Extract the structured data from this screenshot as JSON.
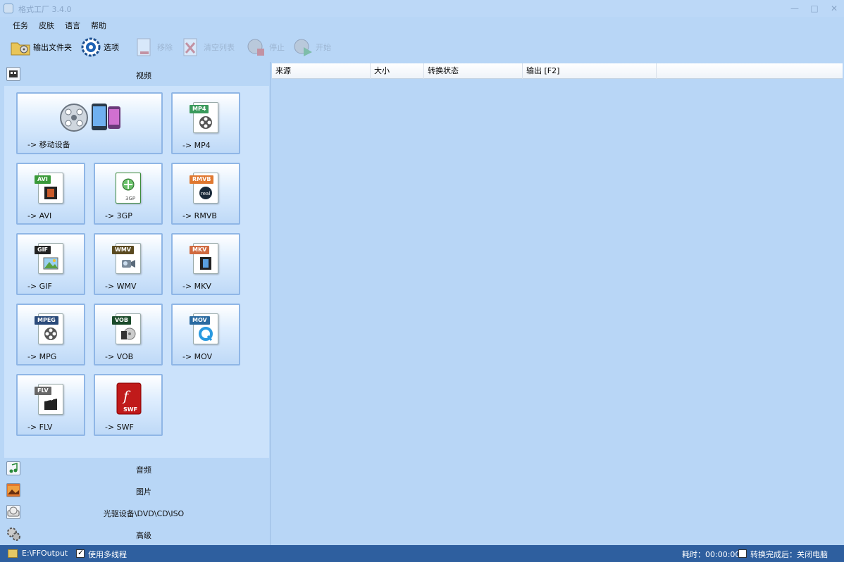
{
  "window": {
    "title": "格式工厂 3.4.0",
    "minimize": "—",
    "maximize": "□",
    "close": "✕"
  },
  "menu": [
    "任务",
    "皮肤",
    "语言",
    "帮助"
  ],
  "toolbar": {
    "output_folder": "输出文件夹",
    "options": "选项",
    "remove": "移除",
    "clear_list": "清空列表",
    "stop": "停止",
    "start": "开始"
  },
  "categories": {
    "video": "视频",
    "audio": "音频",
    "picture": "图片",
    "optical": "光驱设备\\DVD\\CD\\ISO",
    "advanced": "高级"
  },
  "video_tiles": [
    {
      "label": "-> 移动设备",
      "tag": ""
    },
    {
      "label": "-> MP4",
      "tag": "MP4",
      "color": "#3a9a5c"
    },
    {
      "label": "-> AVI",
      "tag": "AVI",
      "color": "#3a9a3a"
    },
    {
      "label": "-> 3GP",
      "tag": "3GP",
      "color": "#4aa050"
    },
    {
      "label": "-> RMVB",
      "tag": "RMVB",
      "color": "#e07830"
    },
    {
      "label": "-> GIF",
      "tag": "GIF",
      "color": "#222222"
    },
    {
      "label": "-> WMV",
      "tag": "WMV",
      "color": "#5a4a20"
    },
    {
      "label": "-> MKV",
      "tag": "MKV",
      "color": "#d06a40"
    },
    {
      "label": "-> MPG",
      "tag": "MPEG",
      "color": "#2a4a7a"
    },
    {
      "label": "-> VOB",
      "tag": "VOB",
      "color": "#1a4a2a"
    },
    {
      "label": "-> MOV",
      "tag": "MOV",
      "color": "#2a6aa0"
    },
    {
      "label": "-> FLV",
      "tag": "FLV",
      "color": "#666666"
    },
    {
      "label": "-> SWF",
      "tag": "SWF",
      "color": "#c01a1a"
    }
  ],
  "columns": [
    "来源",
    "大小",
    "转换状态",
    "输出 [F2]"
  ],
  "status": {
    "path": "E:\\FFOutput",
    "multithread": "使用多线程",
    "elapsed": "耗时：00:00:00",
    "after_done": "转换完成后：关闭电脑"
  }
}
